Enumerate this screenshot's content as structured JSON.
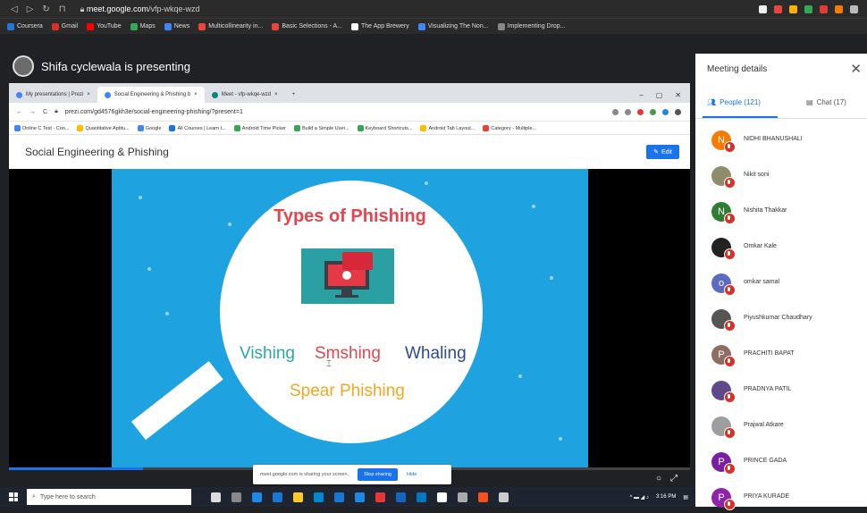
{
  "browser": {
    "url_host": "meet.google.com",
    "url_path": "/vfp-wkqe-wzd",
    "bookmarks": [
      {
        "label": "Coursera",
        "color": "#2a73d9"
      },
      {
        "label": "Gmail",
        "color": "#d93025"
      },
      {
        "label": "YouTube",
        "color": "#ff0000"
      },
      {
        "label": "Maps",
        "color": "#34a853"
      },
      {
        "label": "News",
        "color": "#4285f4"
      },
      {
        "label": "Multicollinearity in...",
        "color": "#e8453c"
      },
      {
        "label": "Basic Selections - A...",
        "color": "#e8453c"
      },
      {
        "label": "The App Brewery",
        "color": "#ffffff"
      },
      {
        "label": "Visualizing The Non...",
        "color": "#4285f4"
      },
      {
        "label": "Implementing Drop...",
        "color": "#888888"
      }
    ]
  },
  "meet": {
    "presenter_text": "Shifa cyclewala is presenting",
    "sharing_text": "meet.google.com is sharing your screen.",
    "stop_sharing": "Stop sharing",
    "hide": "Hide"
  },
  "inner_browser": {
    "tabs": [
      {
        "label": "My presentations | Prezi",
        "color": "#4285f4"
      },
      {
        "label": "Social Engineering & Phishing b",
        "color": "#4285f4"
      },
      {
        "label": "Meet - vfp-wkqe-wzd",
        "color": "#00897b"
      }
    ],
    "url": "prezi.com/gd4576gkh3e/social-engineering-phishing/?present=1",
    "bookmarks": [
      "Online C Test - Con...",
      "Quantitative Aptitu...",
      "Google",
      "All Courses | Learn t...",
      "Android Time Picker",
      "Build a Simple User...",
      "Keyboard Shortcuts...",
      "Android Tab Layout...",
      "Category - Multiple..."
    ]
  },
  "prezi": {
    "title": "Social Engineering & Phishing",
    "edit_label": "Edit"
  },
  "slide": {
    "title": "Types of Phishing",
    "words": [
      {
        "text": "Vishing",
        "color": "#2aa8a8"
      },
      {
        "text": "Smshing",
        "color": "#e8434f"
      },
      {
        "text": "Whaling",
        "color": "#2c4a8c"
      },
      {
        "text": "Spear Phishing",
        "color": "#f5a623"
      }
    ]
  },
  "taskbar": {
    "search_placeholder": "Type here to search",
    "time": "3:16 PM"
  },
  "panel": {
    "title": "Meeting details",
    "people_tab": "People (121)",
    "chat_tab": "Chat (17)",
    "people": [
      {
        "name": "NIDHI BHANUSHALI",
        "initial": "N",
        "color": "#f57c00"
      },
      {
        "name": "Nikit soni",
        "initial": "",
        "color": "#8d8d6e"
      },
      {
        "name": "Nishita Thakkar",
        "initial": "N",
        "color": "#2e7d32"
      },
      {
        "name": "Omkar Kale",
        "initial": "",
        "color": "#222222"
      },
      {
        "name": "omkar samal",
        "initial": "o",
        "color": "#5c6bc0"
      },
      {
        "name": "Piyushkumar Chaudhary",
        "initial": "",
        "color": "#555555"
      },
      {
        "name": "PRACHITI BAPAT",
        "initial": "P",
        "color": "#8d6e63"
      },
      {
        "name": "PRADNYA PATIL",
        "initial": "",
        "color": "#5e4a8a"
      },
      {
        "name": "Prajwal Atkare",
        "initial": "",
        "color": "#9e9e9e"
      },
      {
        "name": "PRINCE GADA",
        "initial": "P",
        "color": "#7b1fa2"
      },
      {
        "name": "PRIYA KURADE",
        "initial": "P",
        "color": "#8e24aa"
      }
    ]
  }
}
